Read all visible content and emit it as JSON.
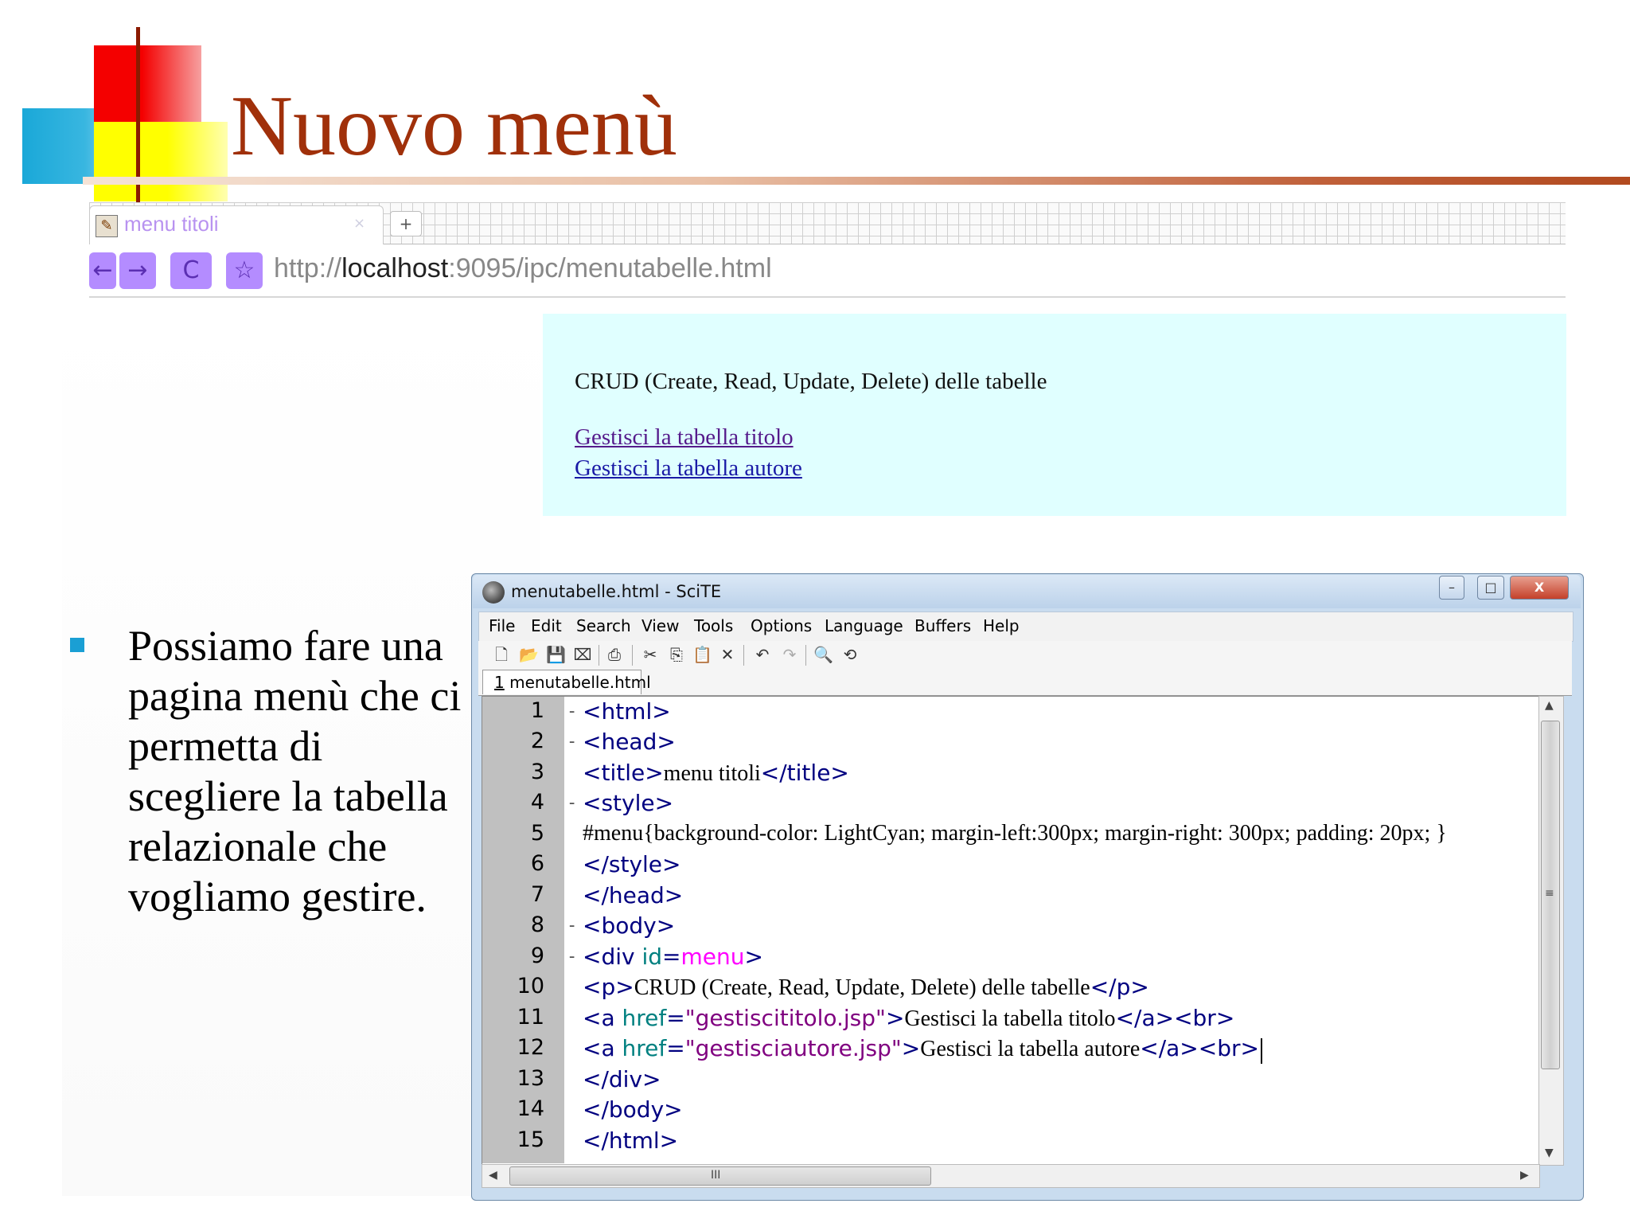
{
  "slide": {
    "title": "Nuovo menù",
    "bullet_text": "Possiamo fare una pagina menù che ci permetta di scegliere la tabella relazionale che vogliamo gestire."
  },
  "browser": {
    "tab_title": "menu titoli",
    "tab_close": "×",
    "new_tab": "+",
    "back": "←",
    "forward": "→",
    "reload": "C",
    "bookmark": "☆",
    "url_scheme": "http://",
    "url_host": "localhost",
    "url_rest": ":9095/ipc/menutabelle.html"
  },
  "page": {
    "crud_text": "CRUD (Create, Read, Update, Delete) delle tabelle",
    "link_titolo": "Gestisci la tabella titolo",
    "link_autore": "Gestisci la tabella autore",
    "background_color": "#e0ffff"
  },
  "editor_window": {
    "title": "menutabelle.html - SciTE",
    "minimize": "–",
    "maximize": "□",
    "close": "X",
    "menu": [
      "File",
      "Edit",
      "Search",
      "View",
      "Tools",
      "Options",
      "Language",
      "Buffers",
      "Help"
    ],
    "file_tab_num": "1",
    "file_tab_name": " menutabelle.html",
    "scroll_grip": "≡",
    "hscroll_grip": "III",
    "line_numbers": [
      "1",
      "2",
      "3",
      "4",
      "5",
      "6",
      "7",
      "8",
      "9",
      "10",
      "11",
      "12",
      "13",
      "14",
      "15"
    ],
    "code": {
      "l1": "<html>",
      "l2": "<head>",
      "l3_open": "<title>",
      "l3_text": "menu titoli",
      "l3_close": "</title>",
      "l4": "<style>",
      "l5": "#menu{background-color: LightCyan; margin-left:300px; margin-right: 300px; padding: 20px; }",
      "l6": "</style>",
      "l7": "</head>",
      "l8": "<body>",
      "l9_open": "<div ",
      "l9_attr": "id",
      "l9_eq": "=",
      "l9_val": "menu",
      "l9_close": ">",
      "l10_open": "<p>",
      "l10_text": "CRUD (Create, Read, Update, Delete) delle tabelle",
      "l10_close": "</p>",
      "l11_open": "<a ",
      "l11_attr": "href",
      "l11_eq": "=",
      "l11_val": "\"gestiscititolo.jsp\"",
      "l11_gt": ">",
      "l11_text": "Gestisci la tabella titolo",
      "l11_close": "</a><br>",
      "l12_open": "<a ",
      "l12_attr": "href",
      "l12_eq": "=",
      "l12_val": "\"gestisciautore.jsp\"",
      "l12_gt": ">",
      "l12_text": "Gestisci la tabella autore",
      "l12_close": "</a><br>",
      "l13": "</div>",
      "l14": "</body>",
      "l15": "</html>"
    }
  },
  "colors": {
    "title": "#a0300a",
    "bullet": "#1a9fd4",
    "tag": "#000080",
    "attribute": "#008080",
    "string": "#800080"
  }
}
